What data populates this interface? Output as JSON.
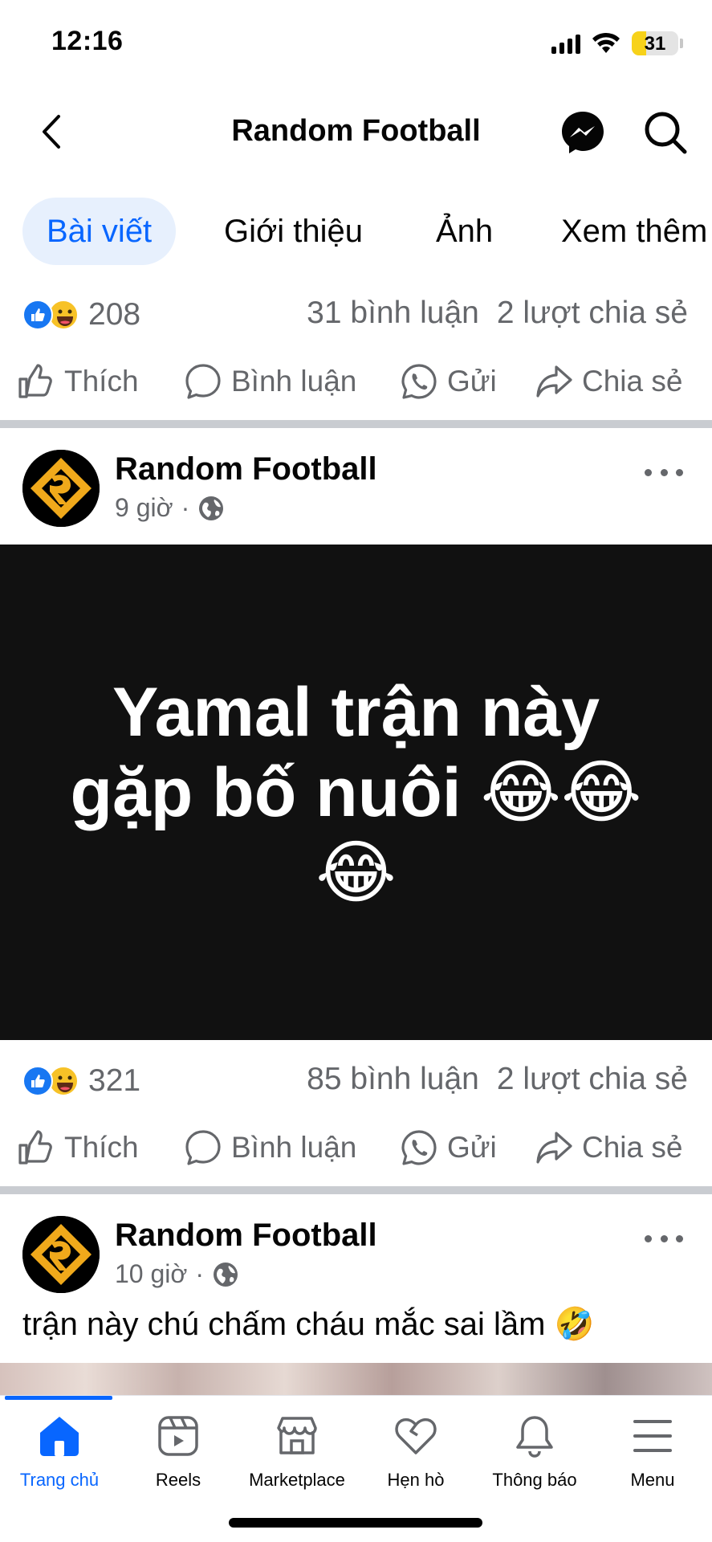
{
  "status_bar": {
    "time": "12:16",
    "battery": "31",
    "battery_fraction": 0.31,
    "battery_color": "#f7d21a"
  },
  "header": {
    "title": "Random Football",
    "back_icon": "chevron-left-icon",
    "messenger_icon": "messenger-icon",
    "search_icon": "search-icon"
  },
  "tabs": [
    {
      "label": "Bài viết",
      "active": true
    },
    {
      "label": "Giới thiệu",
      "active": false
    },
    {
      "label": "Ảnh",
      "active": false
    },
    {
      "label": "Xem thêm",
      "active": false
    }
  ],
  "actions": {
    "like": "Thích",
    "comment": "Bình luận",
    "send": "Gửi",
    "share": "Chia sẻ"
  },
  "posts": [
    {
      "reaction_count": "208",
      "comments": "31 bình luận",
      "shares": "2 lượt chia sẻ"
    },
    {
      "author": "Random Football",
      "time": "9 giờ",
      "separator": "·",
      "image_text": "Yamal trận này gặp bố nuôi 😂😂😂",
      "reaction_count": "321",
      "comments": "85 bình luận",
      "shares": "2 lượt chia sẻ"
    },
    {
      "author": "Random Football",
      "time": "10 giờ",
      "separator": "·",
      "caption": "trận này chú chấm cháu mắc sai lầm 🤣"
    }
  ],
  "bottom_nav": [
    {
      "label": "Trang chủ",
      "icon": "home-icon",
      "active": true
    },
    {
      "label": "Reels",
      "icon": "reels-icon",
      "active": false
    },
    {
      "label": "Marketplace",
      "icon": "marketplace-icon",
      "active": false
    },
    {
      "label": "Hẹn hò",
      "icon": "heart-icon",
      "active": false
    },
    {
      "label": "Thông báo",
      "icon": "bell-icon",
      "active": false
    },
    {
      "label": "Menu",
      "icon": "menu-icon",
      "active": false
    }
  ],
  "colors": {
    "accent": "#0866ff",
    "secondary_text": "#65676b",
    "like_blue": "#1877f2"
  }
}
